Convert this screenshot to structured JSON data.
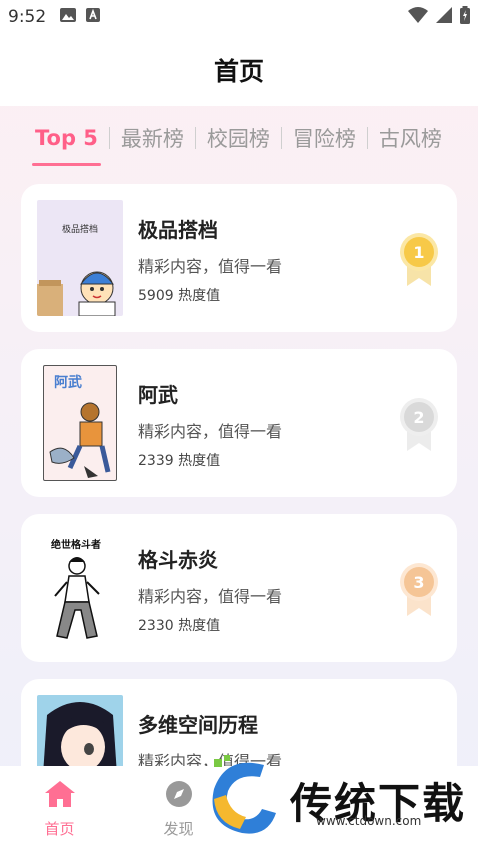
{
  "status_bar": {
    "time": "9:52"
  },
  "header": {
    "title": "首页"
  },
  "tabs": [
    {
      "label": "Top 5",
      "active": true
    },
    {
      "label": "最新榜"
    },
    {
      "label": "校园榜"
    },
    {
      "label": "冒险榜"
    },
    {
      "label": "古风榜"
    }
  ],
  "items": [
    {
      "rank": "1",
      "cover_title": "极品搭档",
      "name": "极品搭档",
      "desc": "精彩内容，值得一看",
      "heat": "5909 热度值",
      "medal_color": "#f7c948"
    },
    {
      "rank": "2",
      "cover_title": "阿武",
      "name": "阿武",
      "desc": "精彩内容，值得一看",
      "heat": "2339 热度值",
      "medal_color": "#d9d9d9"
    },
    {
      "rank": "3",
      "cover_title": "绝世格斗者",
      "name": "格斗赤炎",
      "desc": "精彩内容，值得一看",
      "heat": "2330 热度值",
      "medal_color": "#f5c596"
    },
    {
      "name": "多维空间历程",
      "desc": "精彩内容，值得一看"
    }
  ],
  "bottom_nav": [
    {
      "label": "首页",
      "icon": "home-icon",
      "active": true
    },
    {
      "label": "发现",
      "icon": "compass-icon"
    }
  ],
  "watermark": {
    "text": "传统下载",
    "url": "www.ctdown.com"
  },
  "colors": {
    "accent": "#ff6f93"
  }
}
